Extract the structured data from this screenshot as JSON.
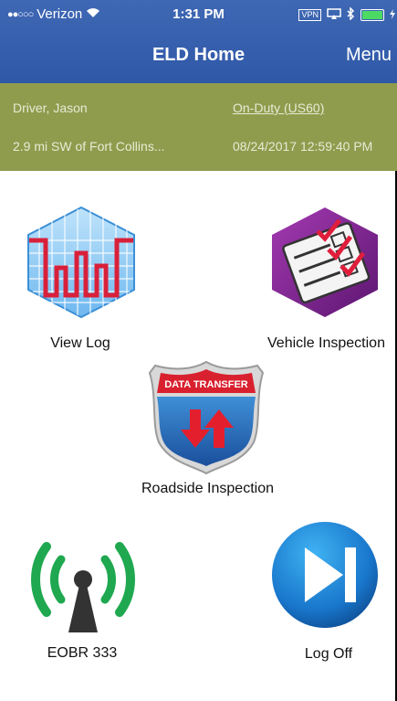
{
  "status_bar": {
    "signal": "●●○○○",
    "carrier": "Verizon",
    "time": "1:31 PM",
    "vpn": "VPN"
  },
  "nav": {
    "title": "ELD Home",
    "menu": "Menu"
  },
  "driver_info": {
    "name": "Driver, Jason",
    "duty_status": "On-Duty (US60)",
    "location": "2.9 mi SW of Fort Collins...",
    "timestamp": "08/24/2017 12:59:40 PM"
  },
  "tiles": {
    "view_log": "View Log",
    "vehicle_inspection": "Vehicle Inspection",
    "data_transfer_badge": "DATA TRANSFER",
    "roadside_inspection": "Roadside Inspection",
    "eobr": "EOBR 333",
    "log_off": "Log Off"
  },
  "colors": {
    "nav_blue": "#3a62b0",
    "olive": "#8f9c4e",
    "battery_green": "#4cd964"
  }
}
